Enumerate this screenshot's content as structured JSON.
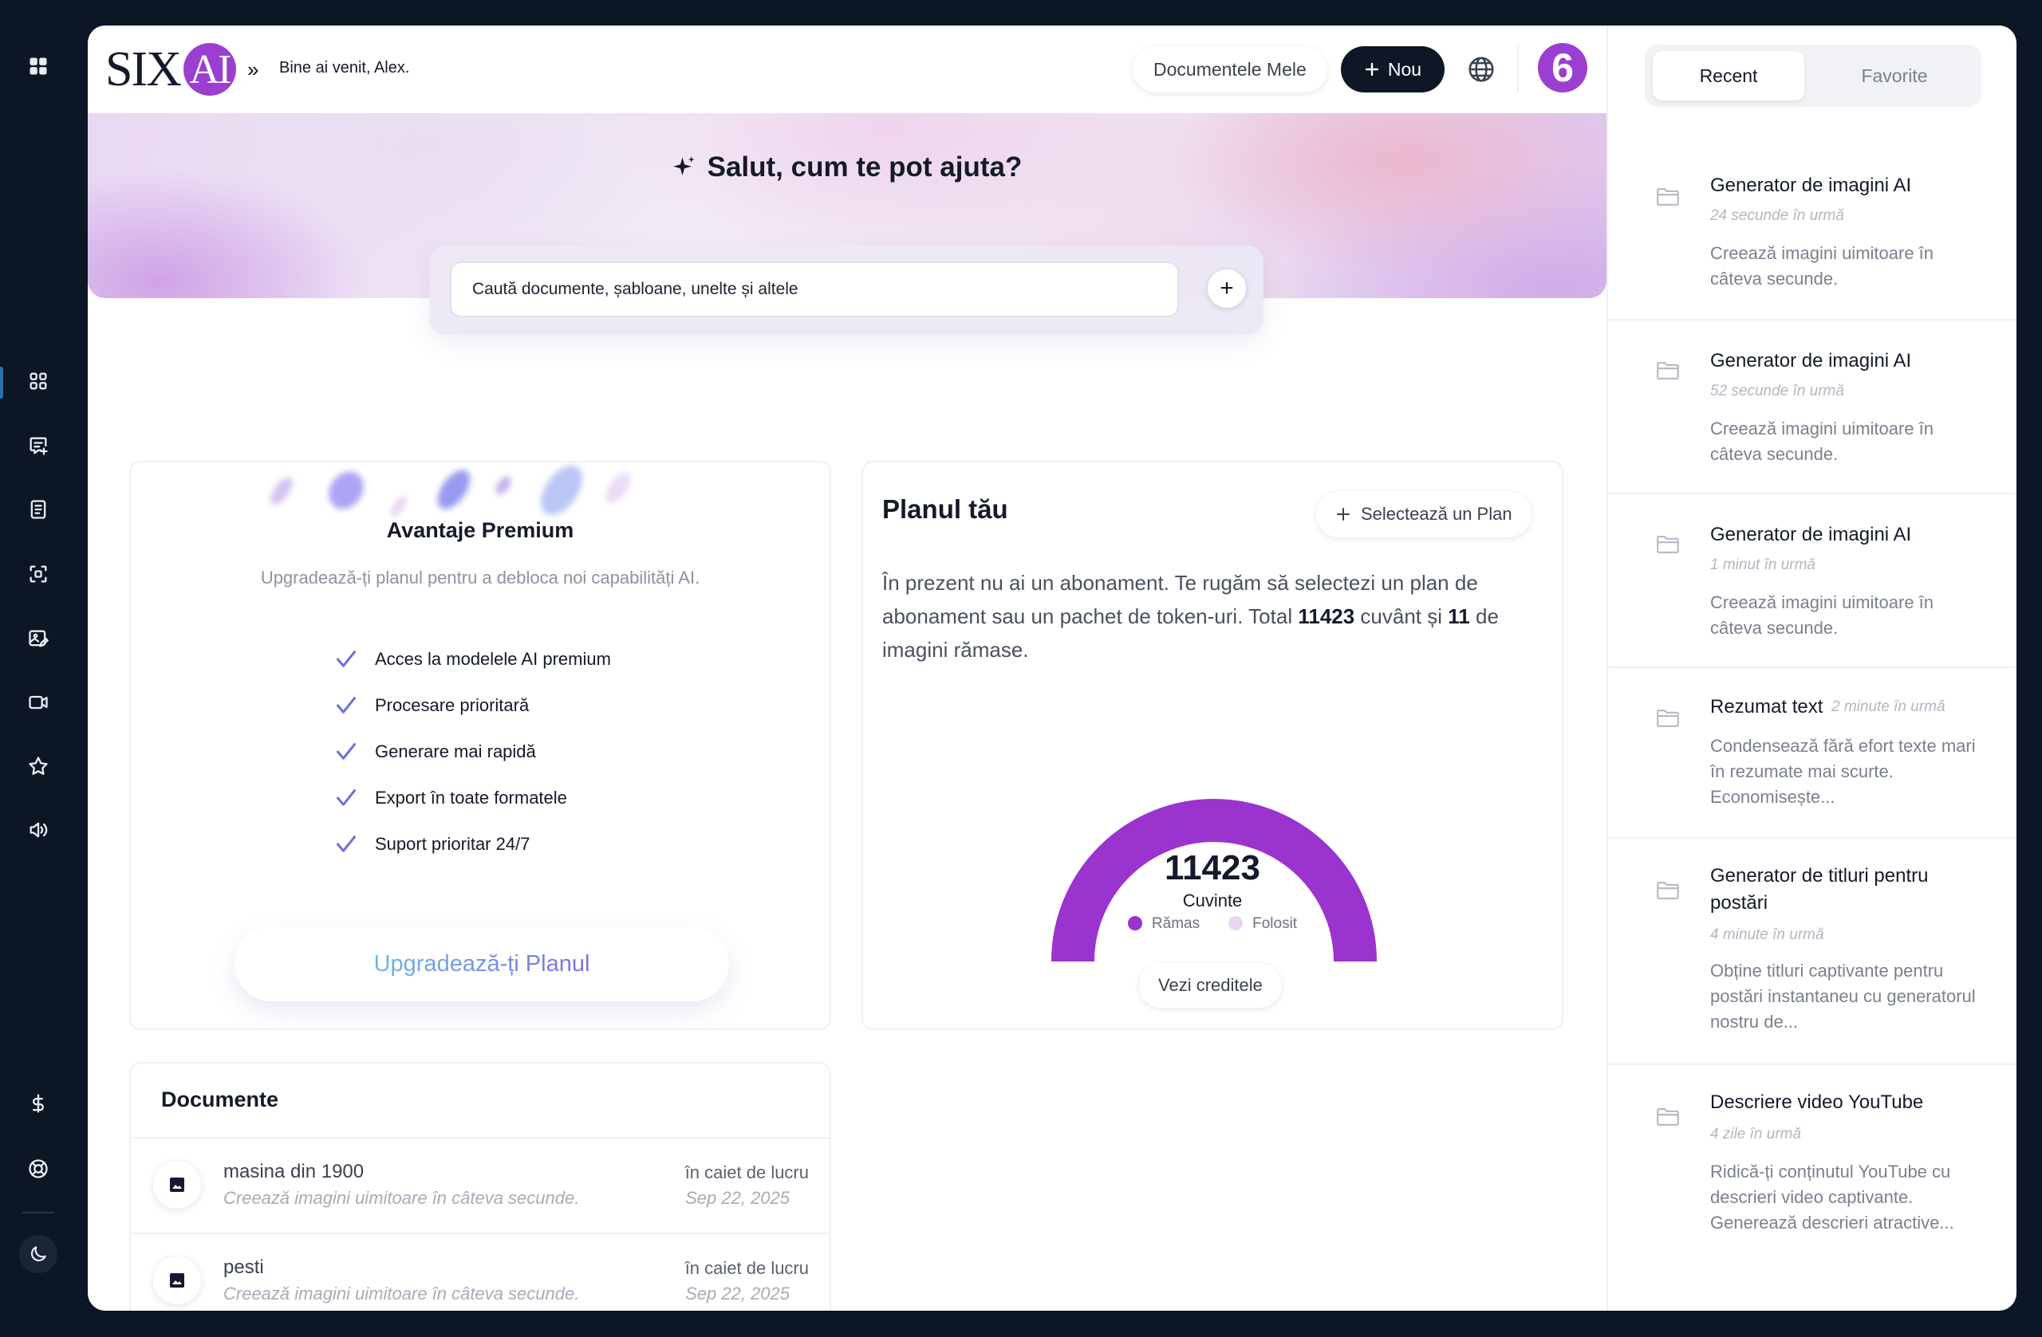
{
  "header": {
    "logo_text": "SIX",
    "logo_badge": "AI",
    "breadcrumb_sep": "»",
    "welcome": "Bine ai venit, Alex.",
    "docs_button": "Documentele Mele",
    "new_button": "Nou",
    "avatar_text": "6"
  },
  "hero": {
    "title": "Salut, cum te pot ajuta?",
    "search_value": "Caută documente, șabloane, unelte și altele",
    "plus_label": "+"
  },
  "premium": {
    "title": "Avantaje Premium",
    "subtitle": "Upgradează-ți planul pentru a debloca noi capabilități AI.",
    "features": [
      "Acces la modelele AI premium",
      "Procesare prioritară",
      "Generare mai rapidă",
      "Export în toate formatele",
      "Suport prioritar 24/7"
    ],
    "button": "Upgradează-ți Planul"
  },
  "plan": {
    "title": "Planul tău",
    "select_button": "Selectează un Plan",
    "text_1": "În prezent nu ai un abonament. Te rugăm să selectezi un plan de abonament sau un pachet de token-uri. Total ",
    "words_total": "11423",
    "text_2": " cuvânt și ",
    "images_total": "11",
    "text_3": " de imagini rămase.",
    "gauge_value": "11423",
    "gauge_unit": "Cuvinte",
    "legend_remaining": "Rămas",
    "legend_used": "Folosit",
    "gauge_remaining_fraction": 1.0,
    "credits_button": "Vezi creditele",
    "colors": {
      "remaining": "#9b33cf",
      "used": "#e6d6f6"
    }
  },
  "documents": {
    "title": "Documente",
    "rows": [
      {
        "name": "masina din 1900",
        "desc": "Creează imagini uimitoare în câteva secunde.",
        "location": "în caiet de lucru",
        "date": "Sep 22, 2025"
      },
      {
        "name": "pesti",
        "desc": "Creează imagini uimitoare în câteva secunde.",
        "location": "în caiet de lucru",
        "date": "Sep 22, 2025"
      }
    ]
  },
  "sidebar_right": {
    "tab_recent": "Recent",
    "tab_favorites": "Favorite",
    "items": [
      {
        "title": "Generator de imagini AI",
        "time": "24 secunde în urmă",
        "desc": "Creează imagini uimitoare în câteva secunde."
      },
      {
        "title": "Generator de imagini AI",
        "time": "52 secunde în urmă",
        "desc": "Creează imagini uimitoare în câteva secunde."
      },
      {
        "title": "Generator de imagini AI",
        "time": "1 minut în urmă",
        "desc": "Creează imagini uimitoare în câteva secunde."
      },
      {
        "title": "Rezumat text",
        "time": "2 minute în urmă",
        "desc": "Condensează fără efort texte mari în rezumate mai scurte. Economisește..."
      },
      {
        "title": "Generator de titluri pentru postări",
        "time": "4 minute în urmă",
        "desc": "Obține titluri captivante pentru postări instantaneu cu generatorul nostru de..."
      },
      {
        "title": "Descriere video YouTube",
        "time": "4 zile în urmă",
        "desc": "Ridică-ți conținutul YouTube cu descrieri video captivante. Generează descrieri atractive..."
      }
    ]
  },
  "left_rail_icons": [
    "apps-grid-icon",
    "dashboard-icon",
    "chat-add-icon",
    "document-icon",
    "scan-icon",
    "image-edit-icon",
    "video-icon",
    "star-icon",
    "audio-icon",
    "dollar-icon",
    "support-icon",
    "moon-icon"
  ]
}
